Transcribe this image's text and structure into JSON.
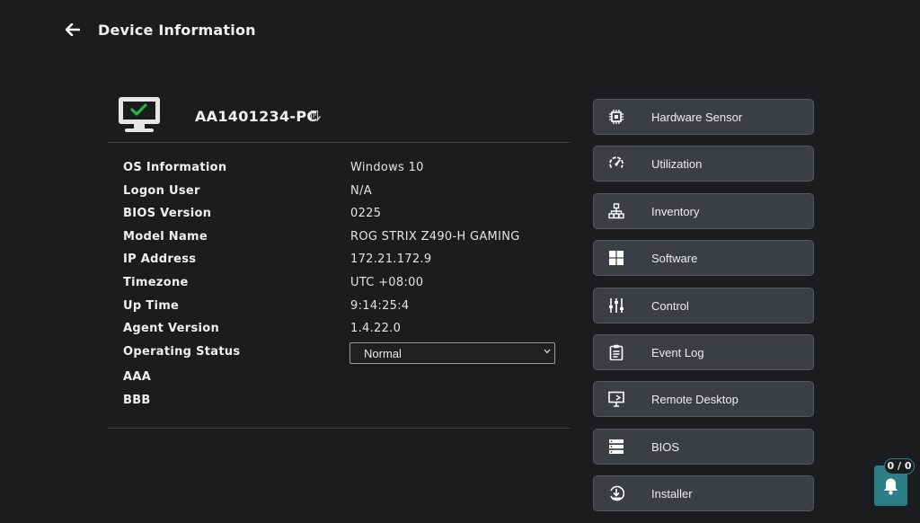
{
  "header": {
    "title": "Device Information"
  },
  "device": {
    "name": "AA1401234-PC"
  },
  "info": {
    "rows": [
      {
        "label": "OS Information",
        "value": "Windows 10"
      },
      {
        "label": "Logon User",
        "value": "N/A"
      },
      {
        "label": "BIOS Version",
        "value": "0225"
      },
      {
        "label": "Model Name",
        "value": "ROG STRIX Z490-H GAMING"
      },
      {
        "label": "IP Address",
        "value": "172.21.172.9"
      },
      {
        "label": "Timezone",
        "value": "UTC +08:00"
      },
      {
        "label": "Up Time",
        "value": "9:14:25:4"
      },
      {
        "label": "Agent Version",
        "value": "1.4.22.0"
      }
    ],
    "operating_status_label": "Operating Status",
    "operating_status_value": "Normal",
    "extra_rows": [
      {
        "label": "AAA",
        "value": ""
      },
      {
        "label": "BBB",
        "value": ""
      }
    ]
  },
  "menu": {
    "items": [
      {
        "label": "Hardware Sensor",
        "icon": "chip-icon"
      },
      {
        "label": "Utilization",
        "icon": "gauge-icon"
      },
      {
        "label": "Inventory",
        "icon": "hierarchy-icon"
      },
      {
        "label": "Software",
        "icon": "windows-icon"
      },
      {
        "label": "Control",
        "icon": "sliders-icon"
      },
      {
        "label": "Event Log",
        "icon": "clipboard-icon"
      },
      {
        "label": "Remote Desktop",
        "icon": "remote-desktop-icon"
      },
      {
        "label": "BIOS",
        "icon": "server-icon"
      },
      {
        "label": "Installer",
        "icon": "installer-icon"
      }
    ]
  },
  "notifications": {
    "count": "0 / 0"
  },
  "colors": {
    "background": "#1b1c1e",
    "button": "#3b3e43",
    "accent": "#2a7f86",
    "check_green": "#22b24c"
  }
}
